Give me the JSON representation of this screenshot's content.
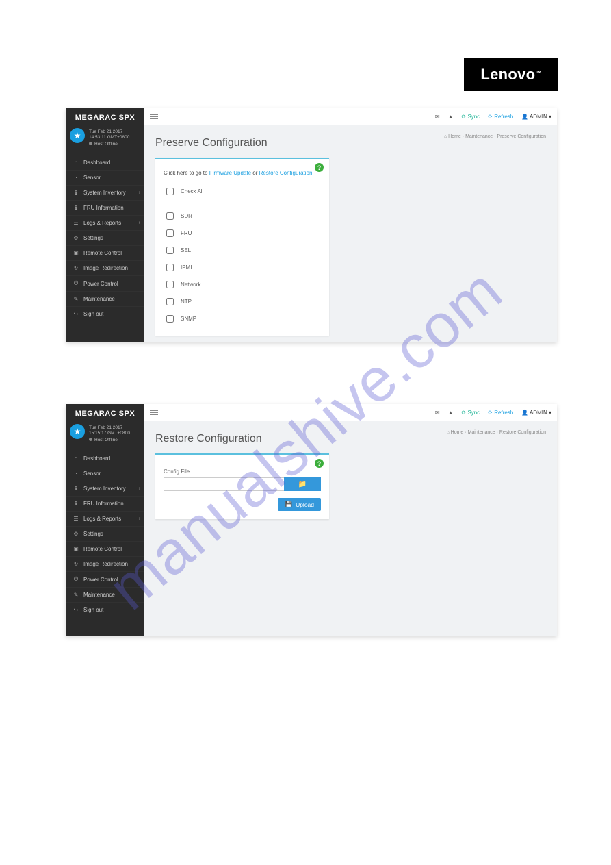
{
  "brand_text": "Lenovo",
  "watermark": "manualshive.com",
  "apptitle": "MEGARAC SPX",
  "topbar": {
    "sync": "Sync",
    "refresh": "Refresh",
    "user": "ADMIN"
  },
  "sidebar_items": [
    {
      "icon": "⌂",
      "label": "Dashboard",
      "sub": false
    },
    {
      "icon": "◔",
      "label": "Sensor",
      "sub": false
    },
    {
      "icon": "ℹ",
      "label": "System Inventory",
      "sub": true
    },
    {
      "icon": "ℹ",
      "label": "FRU Information",
      "sub": false
    },
    {
      "icon": "☰",
      "label": "Logs & Reports",
      "sub": true
    },
    {
      "icon": "⚙",
      "label": "Settings",
      "sub": false
    },
    {
      "icon": "▣",
      "label": "Remote Control",
      "sub": false
    },
    {
      "icon": "↻",
      "label": "Image Redirection",
      "sub": false
    },
    {
      "icon": "⏻",
      "label": "Power Control",
      "sub": false
    },
    {
      "icon": "✎",
      "label": "Maintenance",
      "sub": false
    },
    {
      "icon": "↪",
      "label": "Sign out",
      "sub": false
    }
  ],
  "screenshots": {
    "preserve": {
      "status_date": "Tue Feb 21 2017",
      "status_time": "14:53:11 GMT+0800",
      "status_host": "Host Offline",
      "heading": "Preserve Configuration",
      "bc_home": "Home",
      "bc_mid": "Maintenance",
      "bc_current": "Preserve Configuration",
      "intro_prefix": "Click here to go to ",
      "intro_link1": "Firmware Update",
      "intro_or": " or ",
      "intro_link2": "Restore Configuration",
      "checkall": "Check All",
      "opts": [
        "SDR",
        "FRU",
        "SEL",
        "IPMI",
        "Network",
        "NTP",
        "SNMP"
      ]
    },
    "restore": {
      "status_date": "Tue Feb 21 2017",
      "status_time": "15:15:17 GMT+0800",
      "status_host": "Host Offline",
      "heading": "Restore Configuration",
      "bc_home": "Home",
      "bc_mid": "Maintenance",
      "bc_current": "Restore Configuration",
      "config_label": "Config File",
      "upload": "Upload"
    }
  }
}
